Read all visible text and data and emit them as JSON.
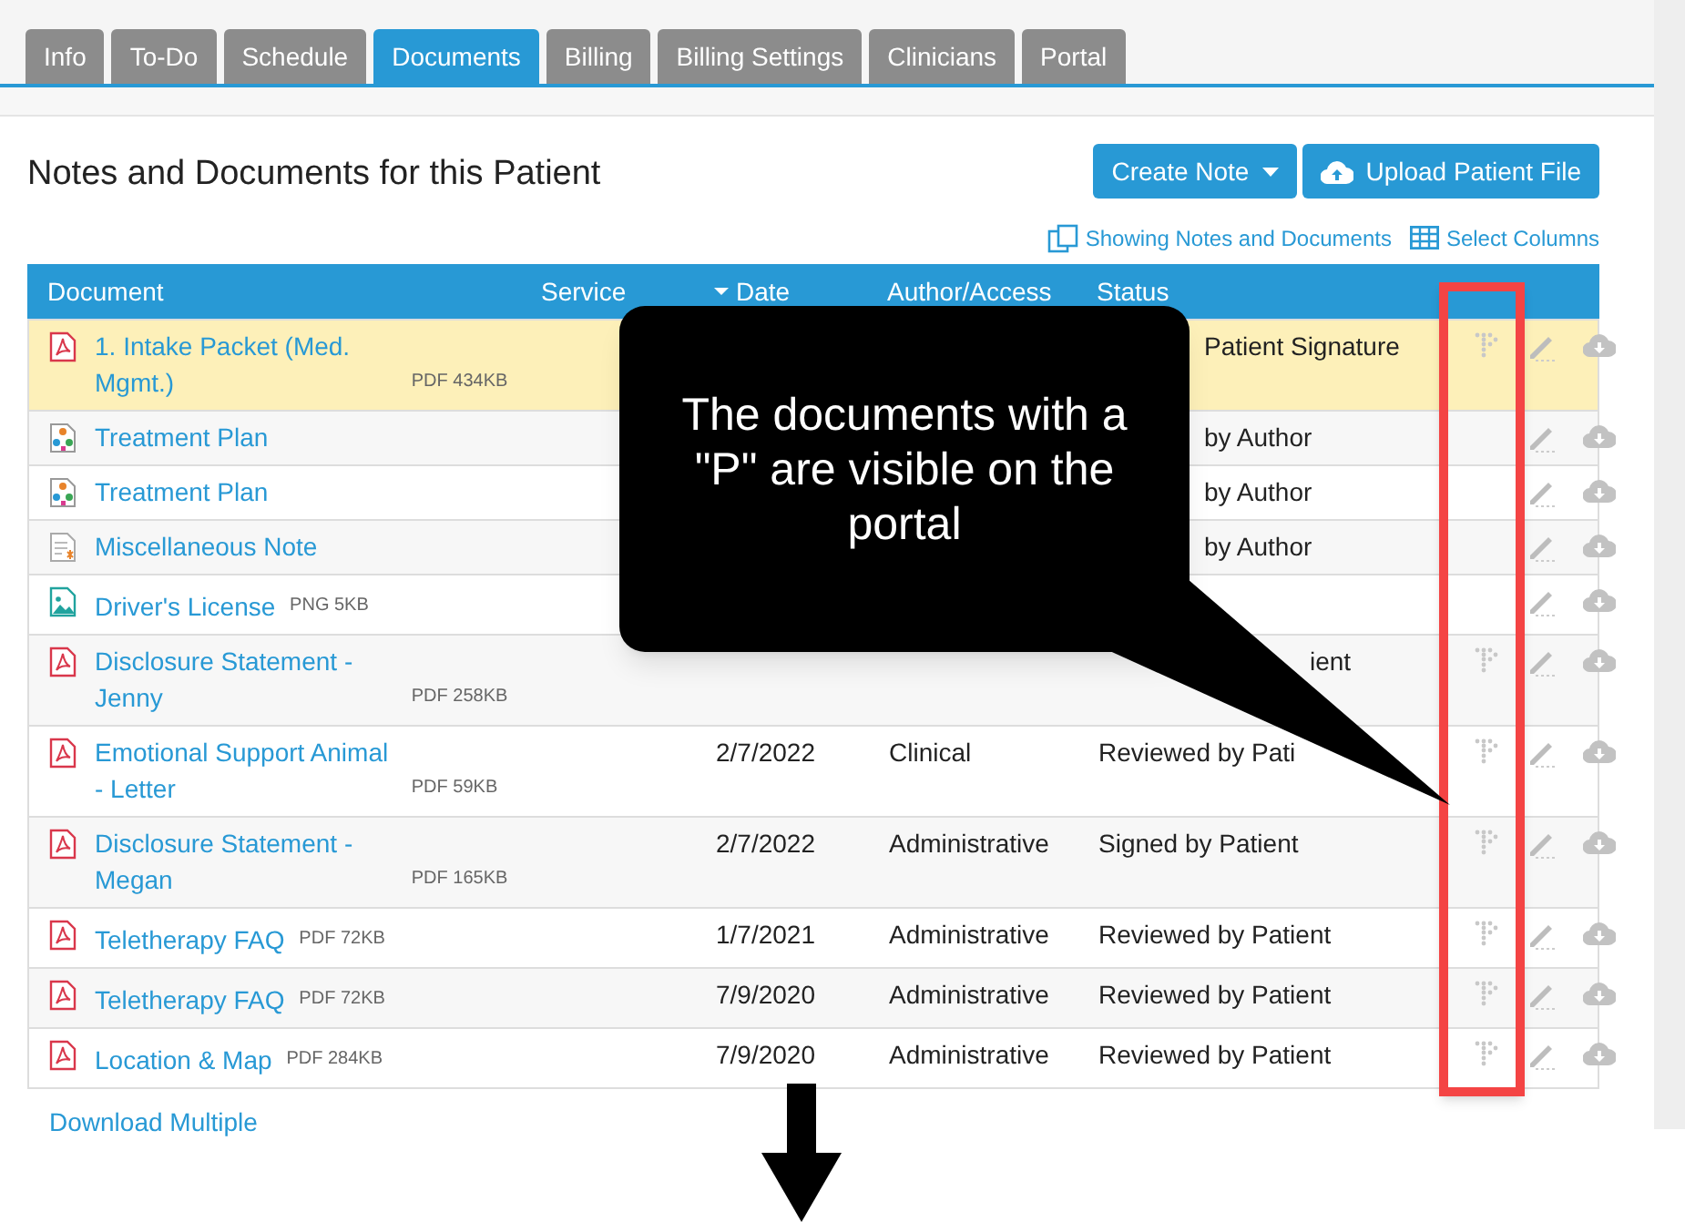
{
  "tabs": [
    {
      "label": "Info",
      "selected": false
    },
    {
      "label": "To-Do",
      "selected": false
    },
    {
      "label": "Schedule",
      "selected": false
    },
    {
      "label": "Documents",
      "selected": true
    },
    {
      "label": "Billing",
      "selected": false
    },
    {
      "label": "Billing Settings",
      "selected": false
    },
    {
      "label": "Clinicians",
      "selected": false
    },
    {
      "label": "Portal",
      "selected": false
    }
  ],
  "heading": "Notes and Documents for this Patient",
  "buttons": [
    {
      "label": "Create Note",
      "kind": "dropdown"
    },
    {
      "label": "Upload Patient File",
      "kind": "upload"
    }
  ],
  "links": [
    {
      "label": "Showing Notes and Documents",
      "kind": "filter"
    },
    {
      "label": "Select Columns",
      "kind": "columns"
    }
  ],
  "table": {
    "columns": [
      {
        "label": "Document",
        "sorted": false
      },
      {
        "label": "Service",
        "sorted": false
      },
      {
        "label": "Date",
        "sorted": true
      },
      {
        "label": "Author/Access",
        "sorted": false
      },
      {
        "label": "Status",
        "sorted": false
      }
    ],
    "rows": [
      {
        "kind": "pdf",
        "name": "1. Intake Packet (Med. Mgmt.)",
        "meta": "PDF 434KB",
        "status": "Patient Signature",
        "portal": true,
        "highlighted": true
      },
      {
        "kind": "plan",
        "name": "Treatment Plan",
        "status": "by Author",
        "portal": false,
        "highlighted": false
      },
      {
        "kind": "plan",
        "name": "Treatment Plan",
        "status": "by Author",
        "portal": false,
        "highlighted": false
      },
      {
        "kind": "note",
        "name": "Miscellaneous Note",
        "status": "by Author",
        "portal": false,
        "highlighted": false
      },
      {
        "kind": "image",
        "name": "Driver's License",
        "meta": "PNG 5KB",
        "portal": false,
        "highlighted": false
      },
      {
        "kind": "pdf",
        "name": "Disclosure Statement - Jenny",
        "meta": "PDF 258KB",
        "status": "ient",
        "portal": true,
        "highlighted": false
      },
      {
        "kind": "pdf",
        "name": "Emotional Support Animal - Letter",
        "meta": "PDF 59KB",
        "date": "2/7/2022",
        "author": "Clinical",
        "status": "Reviewed by Pati",
        "portal": true,
        "highlighted": false
      },
      {
        "kind": "pdf",
        "name": "Disclosure Statement - Megan",
        "meta": "PDF 165KB",
        "date": "2/7/2022",
        "author": "Administrative",
        "status": "Signed by Patient",
        "portal": true,
        "highlighted": false
      },
      {
        "kind": "pdf",
        "name": "Teletherapy FAQ",
        "meta": "PDF 72KB",
        "date": "1/7/2021",
        "author": "Administrative",
        "status": "Reviewed by Patient",
        "portal": true,
        "highlighted": false
      },
      {
        "kind": "pdf",
        "name": "Teletherapy FAQ",
        "meta": "PDF 72KB",
        "date": "7/9/2020",
        "author": "Administrative",
        "status": "Reviewed by Patient",
        "portal": true,
        "highlighted": false
      },
      {
        "kind": "pdf",
        "name": "Location & Map",
        "meta": "PDF 284KB",
        "date": "7/9/2020",
        "author": "Administrative",
        "status": "Reviewed by Patient",
        "portal": true,
        "highlighted": false
      }
    ]
  },
  "footer_link": "Download Multiple",
  "callout": {
    "text": "The documents with a \"P\" are visible on the portal"
  }
}
